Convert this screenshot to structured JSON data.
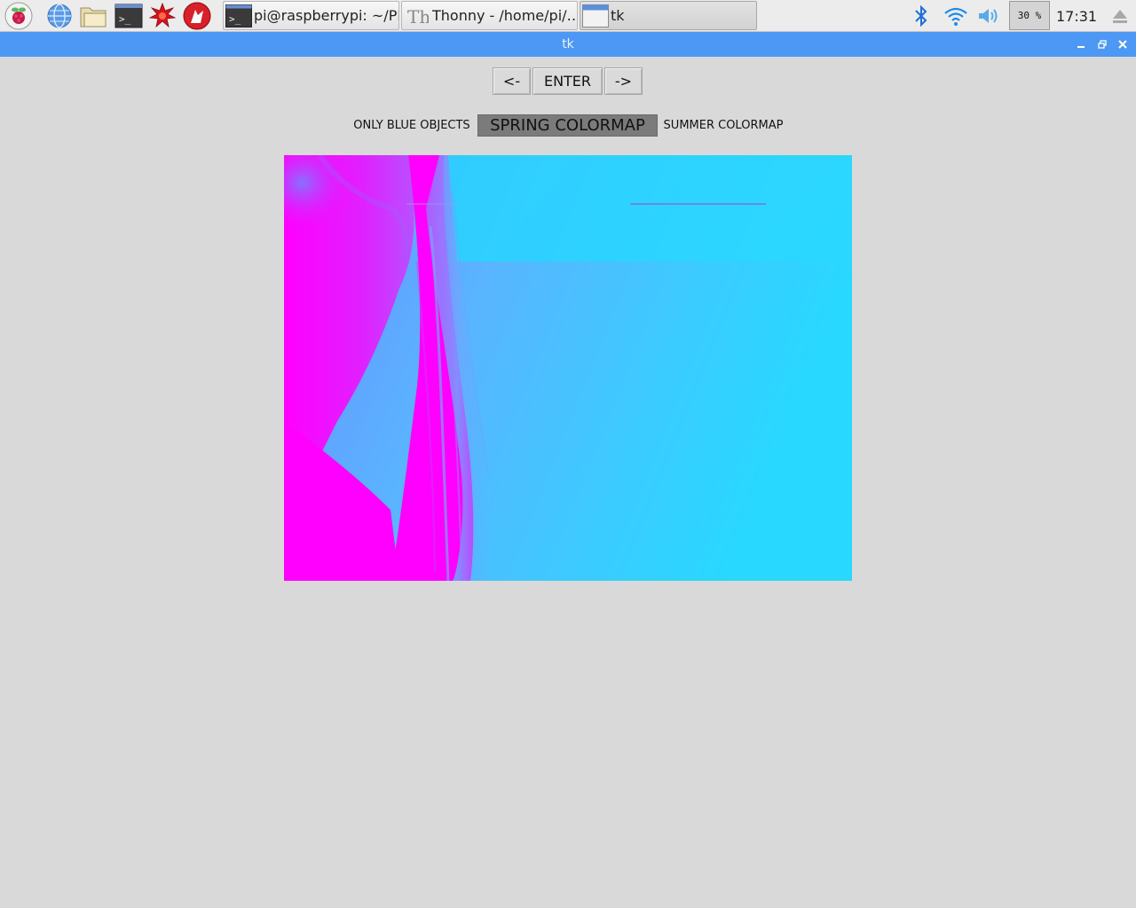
{
  "taskbar": {
    "launchers": [
      {
        "name": "raspberry-menu-icon"
      },
      {
        "name": "web-browser-icon"
      },
      {
        "name": "file-manager-icon"
      },
      {
        "name": "terminal-icon"
      },
      {
        "name": "mathematica-icon"
      },
      {
        "name": "wolfram-icon"
      }
    ],
    "tasks": [
      {
        "label": "pi@raspberrypi: ~/Pl…",
        "icon": "terminal-icon"
      },
      {
        "label": "Thonny  -  /home/pi/…",
        "icon": "thonny-icon"
      },
      {
        "label": "tk",
        "icon": "window-icon"
      }
    ],
    "tray": {
      "bluetooth": "bluetooth-icon",
      "wifi": "wifi-icon",
      "volume": "volume-icon",
      "cpu_usage": "30 %",
      "clock": "17:31",
      "eject": "eject-icon"
    }
  },
  "window": {
    "title": "tk",
    "controls": {
      "minimize": "_",
      "maximize": "▫",
      "close": "✕"
    }
  },
  "nav": {
    "prev_label": "<-",
    "enter_label": "ENTER",
    "next_label": "->"
  },
  "modes": [
    {
      "label": "ONLY BLUE OBJECTS",
      "selected": false
    },
    {
      "label": "SPRING COLORMAP",
      "selected": true
    },
    {
      "label": "SUMMER COLORMAP",
      "selected": false
    }
  ],
  "colors": {
    "titlebar": "#4d98f5",
    "magenta": "#ff00ff",
    "cyan": "#2ad8ff",
    "mid_blue": "#5aa8ff"
  }
}
